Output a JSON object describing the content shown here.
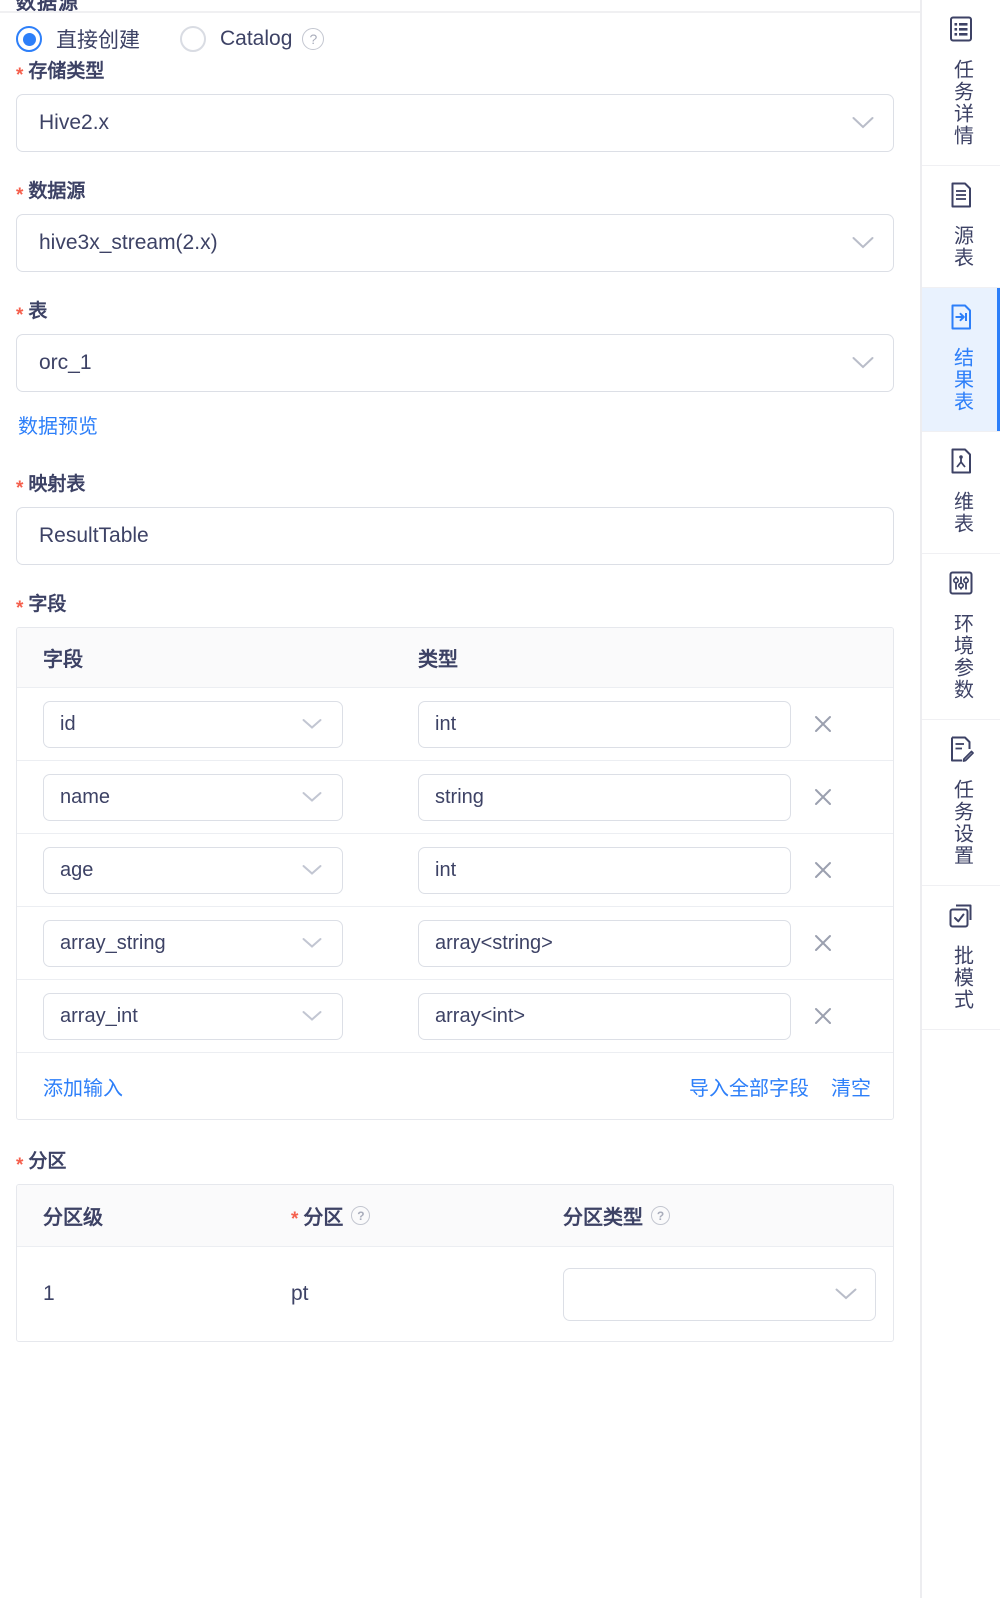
{
  "top_partial_label": "数据源",
  "source_type": {
    "options": [
      {
        "label": "直接创建",
        "selected": true,
        "help": false
      },
      {
        "label": "Catalog",
        "selected": false,
        "help": true
      }
    ]
  },
  "fields": {
    "storage_type": {
      "label": "存储类型",
      "required": true,
      "value": "Hive2.x"
    },
    "datasource": {
      "label": "数据源",
      "required": true,
      "value": "hive3x_stream(2.x)"
    },
    "table": {
      "label": "表",
      "required": true,
      "value": "orc_1"
    },
    "preview_link": "数据预览",
    "mapping_table": {
      "label": "映射表",
      "required": true,
      "value": "ResultTable"
    }
  },
  "columns_section": {
    "label": "字段",
    "required": true,
    "headers": {
      "field": "字段",
      "type": "类型"
    },
    "rows": [
      {
        "field": "id",
        "type": "int"
      },
      {
        "field": "name",
        "type": "string"
      },
      {
        "field": "age",
        "type": "int"
      },
      {
        "field": "array_string",
        "type": "array<string>"
      },
      {
        "field": "array_int",
        "type": "array<int>"
      }
    ],
    "footer": {
      "add": "添加输入",
      "import_all": "导入全部字段",
      "clear": "清空"
    }
  },
  "partition_section": {
    "label": "分区",
    "required": true,
    "headers": {
      "level": "分区级",
      "partition": "分区",
      "partition_required": true,
      "partition_help": "?",
      "type": "分区类型",
      "type_help": "?"
    },
    "rows": [
      {
        "level": "1",
        "partition": "pt",
        "type": ""
      }
    ]
  },
  "sidebar": {
    "items": [
      {
        "label": "任务详情",
        "icon": "task-detail-icon",
        "active": false
      },
      {
        "label": "源表",
        "icon": "source-table-icon",
        "active": false
      },
      {
        "label": "结果表",
        "icon": "result-table-icon",
        "active": true
      },
      {
        "label": "维表",
        "icon": "dim-table-icon",
        "active": false
      },
      {
        "label": "环境参数",
        "icon": "sliders-icon",
        "active": false
      },
      {
        "label": "任务设置",
        "icon": "task-settings-icon",
        "active": false
      },
      {
        "label": "批模式",
        "icon": "batch-mode-icon",
        "active": false
      }
    ]
  },
  "icons": {
    "help": "?",
    "delete": "✕"
  },
  "colors": {
    "accent": "#2d7ff9",
    "required": "#f5604d",
    "text": "#3d4265",
    "border": "#dcdfe6",
    "header_bg": "#fafafb",
    "active_bg": "#e9f2fe"
  }
}
